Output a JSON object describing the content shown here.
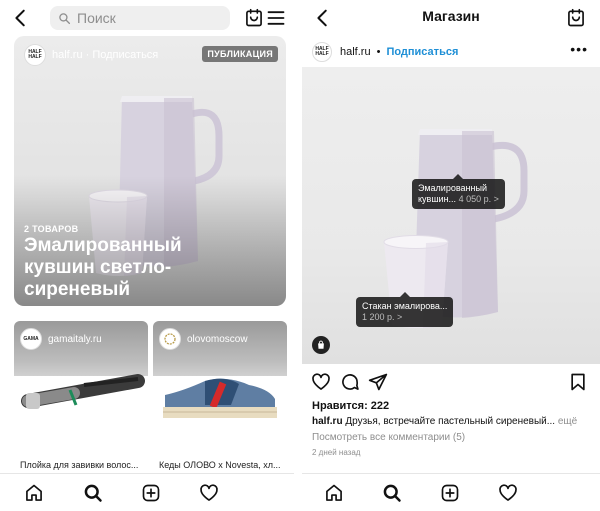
{
  "left": {
    "search": {
      "placeholder": "Поиск"
    },
    "featured": {
      "account": "half.ru",
      "follow": "Подписаться",
      "logo_text": "HALF HALF",
      "badge": "ПУБЛИКАЦИЯ",
      "items_count": "2 ТОВАРОВ",
      "title": "Эмалированный кувшин светло-сиреневый"
    },
    "cards": [
      {
        "account": "gamaitaly.ru",
        "logo_text": "GAMA",
        "caption": "Плойка для завивки волос..."
      },
      {
        "account": "olovomoscow",
        "logo_text": "",
        "caption": "Кеды ОЛОВО x Novesta, хл..."
      }
    ]
  },
  "right": {
    "title": "Магазин",
    "account": "half.ru",
    "separator": "•",
    "follow": "Подписаться",
    "logo_text": "HALF HALF",
    "tags": [
      {
        "name": "Эмалированный",
        "name2": "кувшин...",
        "price": "4 050 р.",
        "arrow": ">"
      },
      {
        "name": "Стакан эмалирова...",
        "price": "1 200 р.",
        "arrow": ">"
      }
    ],
    "likes": "Нравится: 222",
    "caption_account": "half.ru",
    "caption_text": "Друзья, встречайте пастельный сиреневый...",
    "caption_more": "ещё",
    "view_comments": "Посмотреть все комментарии (5)",
    "time_ago": "2 дней назад"
  },
  "icons": {
    "back": "back-arrow-icon",
    "search": "search-icon",
    "shop": "shop-icon",
    "menu": "menu-icon",
    "home": "home-icon",
    "add": "add-icon",
    "heart": "heart-icon",
    "comment": "comment-icon",
    "share": "share-icon",
    "save": "save-icon",
    "bag": "bag-icon"
  },
  "colors": {
    "accent": "#1e8fd6",
    "badge_bg": "#5a5a5a",
    "tag_bg": "#141414",
    "pitcher": "#d7d2df"
  }
}
